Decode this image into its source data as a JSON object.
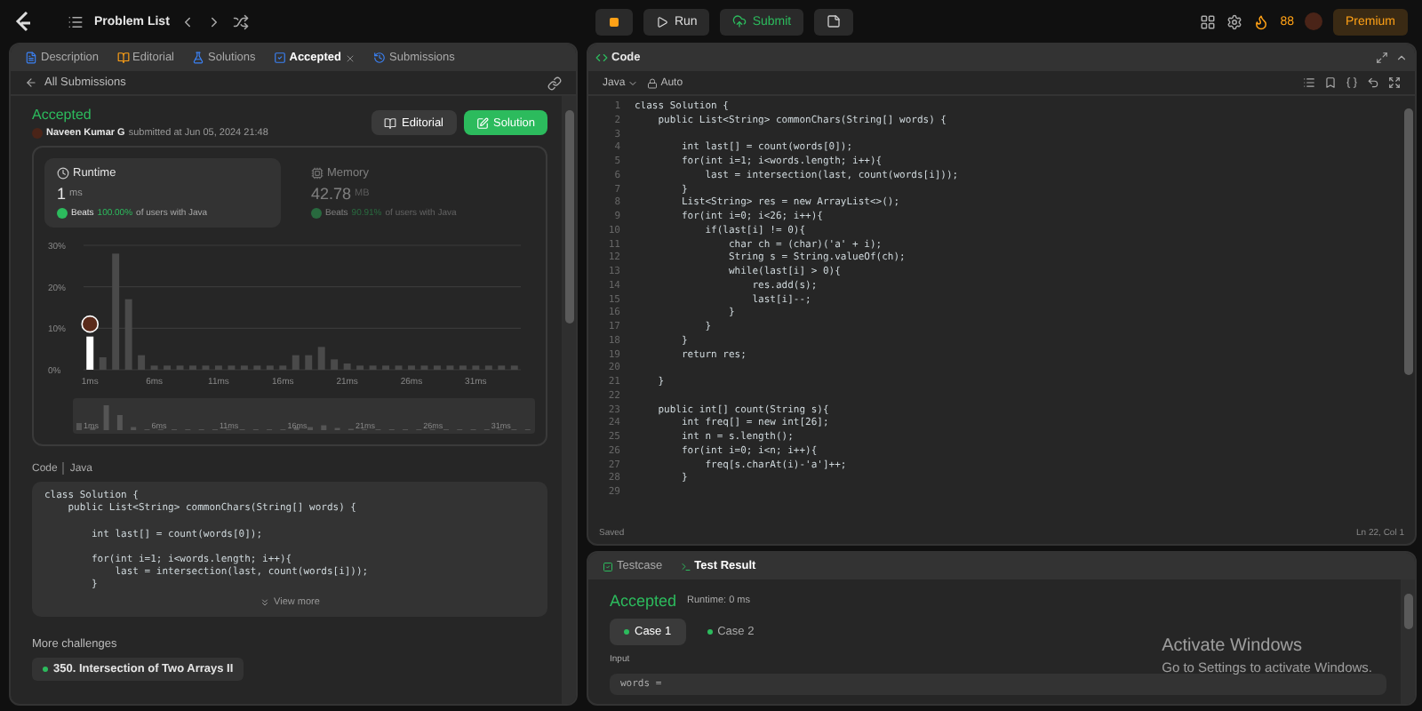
{
  "topbar": {
    "title": "Problem List",
    "run": "Run",
    "submit": "Submit",
    "streak": "88",
    "premium": "Premium"
  },
  "left_tabs": [
    {
      "label": "Description",
      "selected": false,
      "closable": false
    },
    {
      "label": "Editorial",
      "selected": false,
      "closable": false
    },
    {
      "label": "Solutions",
      "selected": false,
      "closable": false
    },
    {
      "label": "Accepted",
      "selected": true,
      "closable": true
    },
    {
      "label": "Submissions",
      "selected": false,
      "closable": false
    }
  ],
  "back_link": "All Submissions",
  "submission": {
    "status": "Accepted",
    "author": "Naveen Kumar G",
    "submitted": "submitted at Jun 05, 2024 21:48",
    "buttons": [
      {
        "label": "Editorial",
        "kind": "secondary"
      },
      {
        "label": "Solution",
        "kind": "primary"
      }
    ]
  },
  "stats": [
    {
      "kind": "runtime",
      "title": "Runtime",
      "value": "1",
      "unit": "ms",
      "beats_label": "Beats",
      "beats": "100.00%",
      "suffix": "of users with Java",
      "selected": true
    },
    {
      "kind": "memory",
      "title": "Memory",
      "value": "42.78",
      "unit": "MB",
      "beats_label": "Beats",
      "beats": "90.91%",
      "suffix": "of users with Java",
      "selected": false
    }
  ],
  "chart_data": {
    "type": "bar",
    "x": [
      1,
      2,
      3,
      4,
      5,
      6,
      7,
      8,
      9,
      10,
      11,
      12,
      13,
      14,
      15,
      16,
      17,
      18,
      19,
      20,
      21,
      22,
      23,
      24,
      25,
      26,
      27,
      28,
      29,
      30,
      31,
      32,
      33,
      34
    ],
    "series": [
      {
        "color": "#ffffff",
        "values": [
          8,
          null,
          null,
          null,
          null,
          null,
          null,
          null,
          null,
          null,
          null,
          null,
          null,
          null,
          null,
          null,
          null,
          null,
          null,
          null,
          null,
          null,
          null,
          null,
          null,
          null,
          null,
          null,
          null,
          null,
          null,
          null,
          null,
          null
        ]
      },
      {
        "color": "#4a4a4a",
        "values": [
          null,
          3,
          28,
          17,
          3.5,
          1,
          1,
          1,
          1,
          1,
          1,
          1,
          1,
          1,
          1,
          1,
          3.5,
          3.5,
          5.5,
          2.5,
          1.5,
          1,
          1,
          1,
          1,
          1,
          1,
          1,
          1,
          1,
          1,
          1,
          1,
          1
        ]
      }
    ],
    "xlim": [
      0.5,
      34.5
    ],
    "ylim": [
      0,
      30
    ],
    "grid": true,
    "yticks": [
      {
        "value": 0,
        "label": "0%"
      },
      {
        "value": 10,
        "label": "10%"
      },
      {
        "value": 20,
        "label": "20%"
      },
      {
        "value": 30,
        "label": "30%"
      }
    ],
    "xticks": [
      {
        "value": 1,
        "label": "1ms"
      },
      {
        "value": 6,
        "label": "6ms"
      },
      {
        "value": 11,
        "label": "11ms"
      },
      {
        "value": 16,
        "label": "16ms"
      },
      {
        "value": 21,
        "label": "21ms"
      },
      {
        "value": 26,
        "label": "26ms"
      },
      {
        "value": 31,
        "label": "31ms"
      }
    ]
  },
  "brush_labels": [
    "1ms",
    "6ms",
    "11ms",
    "16ms",
    "21ms",
    "26ms",
    "31ms"
  ],
  "code_preview": {
    "label": "Code",
    "language": "Java",
    "lines": [
      {
        "kind": "code",
        "code": "class Solution {"
      },
      {
        "kind": "code",
        "code": "    public List<String> commonChars(String[] words) {"
      },
      {
        "kind": "blank"
      },
      {
        "kind": "code",
        "code": "        int last[] = count(words[0]);"
      },
      {
        "kind": "blank"
      },
      {
        "kind": "code",
        "code": "        for(int i=1; i<words.length; i++){"
      },
      {
        "kind": "code",
        "code": "            last = intersection(last, count(words[i]));"
      },
      {
        "kind": "code",
        "code": "        }"
      }
    ],
    "view_more": "View more"
  },
  "more_challenges": {
    "title": "More challenges",
    "items": [
      "350. Intersection of Two Arrays II"
    ]
  },
  "editor": {
    "title": "Code",
    "language": "Java",
    "mode": "Auto",
    "status": "Saved",
    "position": "Ln 22, Col 1",
    "lines": [
      {
        "n": "1",
        "code": "class Solution {"
      },
      {
        "n": "2",
        "code": "    public List<String> commonChars(String[] words) {"
      },
      {
        "n": "3"
      },
      {
        "n": "4",
        "code": "        int last[] = count(words[0]);"
      },
      {
        "n": "5",
        "code": "        for(int i=1; i<words.length; i++){"
      },
      {
        "n": "6",
        "code": "            last = intersection(last, count(words[i]));"
      },
      {
        "n": "7",
        "code": "        }"
      },
      {
        "n": "8",
        "code": "        List<String> res = new ArrayList<>();"
      },
      {
        "n": "9",
        "code": "        for(int i=0; i<26; i++){"
      },
      {
        "n": "10",
        "code": "            if(last[i] != 0){"
      },
      {
        "n": "11",
        "code": "                char ch = (char)('a' + i);"
      },
      {
        "n": "12",
        "code": "                String s = String.valueOf(ch);"
      },
      {
        "n": "13",
        "code": "                while(last[i] > 0){"
      },
      {
        "n": "14",
        "code": "                    res.add(s);"
      },
      {
        "n": "15",
        "code": "                    last[i]--;"
      },
      {
        "n": "16",
        "code": "                }"
      },
      {
        "n": "17",
        "code": "            }"
      },
      {
        "n": "18",
        "code": "        }"
      },
      {
        "n": "19",
        "code": "        return res;"
      },
      {
        "n": "20"
      },
      {
        "n": "21",
        "code": "    }"
      },
      {
        "n": "22"
      },
      {
        "n": "23",
        "code": "    public int[] count(String s){"
      },
      {
        "n": "24",
        "code": "        int freq[] = new int[26];"
      },
      {
        "n": "25",
        "code": "        int n = s.length();"
      },
      {
        "n": "26",
        "code": "        for(int i=0; i<n; i++){"
      },
      {
        "n": "27",
        "code": "            freq[s.charAt(i)-'a']++;"
      },
      {
        "n": "28",
        "code": "        }"
      },
      {
        "n": "29"
      }
    ]
  },
  "result": {
    "tabs": [
      {
        "label": "Testcase",
        "selected": false
      },
      {
        "label": "Test Result",
        "selected": true
      }
    ],
    "status": "Accepted",
    "runtime": "Runtime: 0 ms",
    "cases": [
      {
        "label": "Case 1",
        "selected": true
      },
      {
        "label": "Case 2",
        "selected": false
      }
    ],
    "input_label": "Input",
    "input_value": "words ="
  },
  "os_notice": {
    "title": "Activate Windows",
    "text": "Go to Settings to activate Windows."
  }
}
